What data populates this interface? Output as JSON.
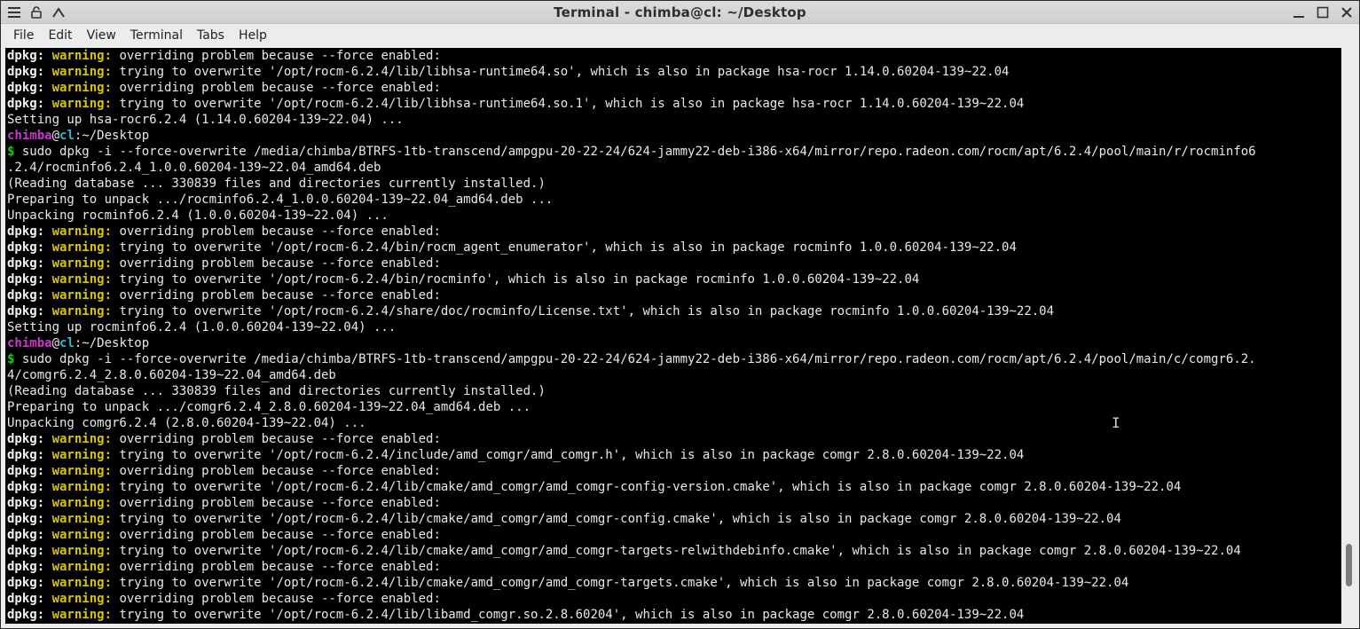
{
  "window": {
    "title": "Terminal - chimba@cl: ~/Desktop"
  },
  "titlebar_icons": {
    "left": [
      "menu-icon",
      "unlock-icon",
      "pin-up-icon"
    ],
    "right": [
      "minimize-icon",
      "maximize-icon",
      "close-icon"
    ]
  },
  "menu": [
    "File",
    "Edit",
    "View",
    "Terminal",
    "Tabs",
    "Help"
  ],
  "colors": {
    "warning": "#d9c400",
    "user": "#c83ac8",
    "host": "#2fb8c8",
    "prompt": "#21c41b",
    "bg": "#000000"
  },
  "scrollbar": {
    "position_fraction": 0.93
  },
  "terminal_lines": [
    {
      "type": "warn",
      "prefix": "dpkg: ",
      "warning": "warning:",
      "text": " overriding problem because --force enabled:"
    },
    {
      "type": "warn",
      "prefix": "dpkg: ",
      "warning": "warning:",
      "text": " trying to overwrite '/opt/rocm-6.2.4/lib/libhsa-runtime64.so', which is also in package hsa-rocr 1.14.0.60204-139~22.04"
    },
    {
      "type": "warn",
      "prefix": "dpkg: ",
      "warning": "warning:",
      "text": " overriding problem because --force enabled:"
    },
    {
      "type": "warn",
      "prefix": "dpkg: ",
      "warning": "warning:",
      "text": " trying to overwrite '/opt/rocm-6.2.4/lib/libhsa-runtime64.so.1', which is also in package hsa-rocr 1.14.0.60204-139~22.04"
    },
    {
      "type": "plain",
      "text": "Setting up hsa-rocr6.2.4 (1.14.0.60204-139~22.04) ..."
    },
    {
      "type": "prompt",
      "user": "chimba",
      "at": "@",
      "host": "cl",
      "path": ":~/Desktop"
    },
    {
      "type": "cmd",
      "dollar": "$",
      "text": " sudo dpkg -i --force-overwrite /media/chimba/BTRFS-1tb-transcend/ampgpu-20-22-24/624-jammy22-deb-i386-x64/mirror/repo.radeon.com/rocm/apt/6.2.4/pool/main/r/rocminfo6"
    },
    {
      "type": "plain",
      "text": ".2.4/rocminfo6.2.4_1.0.0.60204-139~22.04_amd64.deb"
    },
    {
      "type": "plain",
      "text": "(Reading database ... 330839 files and directories currently installed.)"
    },
    {
      "type": "plain",
      "text": "Preparing to unpack .../rocminfo6.2.4_1.0.0.60204-139~22.04_amd64.deb ..."
    },
    {
      "type": "plain",
      "text": "Unpacking rocminfo6.2.4 (1.0.0.60204-139~22.04) ..."
    },
    {
      "type": "warn",
      "prefix": "dpkg: ",
      "warning": "warning:",
      "text": " overriding problem because --force enabled:"
    },
    {
      "type": "warn",
      "prefix": "dpkg: ",
      "warning": "warning:",
      "text": " trying to overwrite '/opt/rocm-6.2.4/bin/rocm_agent_enumerator', which is also in package rocminfo 1.0.0.60204-139~22.04"
    },
    {
      "type": "warn",
      "prefix": "dpkg: ",
      "warning": "warning:",
      "text": " overriding problem because --force enabled:"
    },
    {
      "type": "warn",
      "prefix": "dpkg: ",
      "warning": "warning:",
      "text": " trying to overwrite '/opt/rocm-6.2.4/bin/rocminfo', which is also in package rocminfo 1.0.0.60204-139~22.04"
    },
    {
      "type": "warn",
      "prefix": "dpkg: ",
      "warning": "warning:",
      "text": " overriding problem because --force enabled:"
    },
    {
      "type": "warn",
      "prefix": "dpkg: ",
      "warning": "warning:",
      "text": " trying to overwrite '/opt/rocm-6.2.4/share/doc/rocminfo/License.txt', which is also in package rocminfo 1.0.0.60204-139~22.04"
    },
    {
      "type": "plain",
      "text": "Setting up rocminfo6.2.4 (1.0.0.60204-139~22.04) ..."
    },
    {
      "type": "prompt",
      "user": "chimba",
      "at": "@",
      "host": "cl",
      "path": ":~/Desktop"
    },
    {
      "type": "cmd",
      "dollar": "$",
      "text": " sudo dpkg -i --force-overwrite /media/chimba/BTRFS-1tb-transcend/ampgpu-20-22-24/624-jammy22-deb-i386-x64/mirror/repo.radeon.com/rocm/apt/6.2.4/pool/main/c/comgr6.2."
    },
    {
      "type": "plain",
      "text": "4/comgr6.2.4_2.8.0.60204-139~22.04_amd64.deb"
    },
    {
      "type": "plain",
      "text": "(Reading database ... 330839 files and directories currently installed.)"
    },
    {
      "type": "plain",
      "text": "Preparing to unpack .../comgr6.2.4_2.8.0.60204-139~22.04_amd64.deb ..."
    },
    {
      "type": "plain",
      "text": "Unpacking comgr6.2.4 (2.8.0.60204-139~22.04) ..."
    },
    {
      "type": "warn",
      "prefix": "dpkg: ",
      "warning": "warning:",
      "text": " overriding problem because --force enabled:"
    },
    {
      "type": "warn",
      "prefix": "dpkg: ",
      "warning": "warning:",
      "text": " trying to overwrite '/opt/rocm-6.2.4/include/amd_comgr/amd_comgr.h', which is also in package comgr 2.8.0.60204-139~22.04"
    },
    {
      "type": "warn",
      "prefix": "dpkg: ",
      "warning": "warning:",
      "text": " overriding problem because --force enabled:"
    },
    {
      "type": "warn",
      "prefix": "dpkg: ",
      "warning": "warning:",
      "text": " trying to overwrite '/opt/rocm-6.2.4/lib/cmake/amd_comgr/amd_comgr-config-version.cmake', which is also in package comgr 2.8.0.60204-139~22.04"
    },
    {
      "type": "warn",
      "prefix": "dpkg: ",
      "warning": "warning:",
      "text": " overriding problem because --force enabled:"
    },
    {
      "type": "warn",
      "prefix": "dpkg: ",
      "warning": "warning:",
      "text": " trying to overwrite '/opt/rocm-6.2.4/lib/cmake/amd_comgr/amd_comgr-config.cmake', which is also in package comgr 2.8.0.60204-139~22.04"
    },
    {
      "type": "warn",
      "prefix": "dpkg: ",
      "warning": "warning:",
      "text": " overriding problem because --force enabled:"
    },
    {
      "type": "warn",
      "prefix": "dpkg: ",
      "warning": "warning:",
      "text": " trying to overwrite '/opt/rocm-6.2.4/lib/cmake/amd_comgr/amd_comgr-targets-relwithdebinfo.cmake', which is also in package comgr 2.8.0.60204-139~22.04"
    },
    {
      "type": "warn",
      "prefix": "dpkg: ",
      "warning": "warning:",
      "text": " overriding problem because --force enabled:"
    },
    {
      "type": "warn",
      "prefix": "dpkg: ",
      "warning": "warning:",
      "text": " trying to overwrite '/opt/rocm-6.2.4/lib/cmake/amd_comgr/amd_comgr-targets.cmake', which is also in package comgr 2.8.0.60204-139~22.04"
    },
    {
      "type": "warn",
      "prefix": "dpkg: ",
      "warning": "warning:",
      "text": " overriding problem because --force enabled:"
    },
    {
      "type": "warn",
      "prefix": "dpkg: ",
      "warning": "warning:",
      "text": " trying to overwrite '/opt/rocm-6.2.4/lib/libamd_comgr.so.2.8.60204', which is also in package comgr 2.8.0.60204-139~22.04"
    }
  ]
}
